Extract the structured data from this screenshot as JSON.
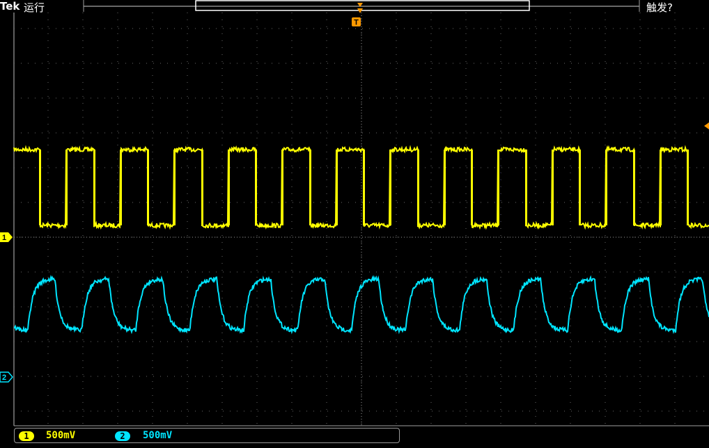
{
  "header": {
    "brand": "Tek",
    "run_state": "运行",
    "trigger_status": "触发?"
  },
  "markers": {
    "trigger_position": "T",
    "channel1_ground": "1",
    "channel2_ground": "2"
  },
  "channels": [
    {
      "id": "1",
      "scale": "500mV",
      "color": "#ffff00"
    },
    {
      "id": "2",
      "scale": "500mV",
      "color": "#00e5ff"
    }
  ],
  "colors": {
    "background": "#000000",
    "grid": "#7a7a7a",
    "frame": "#a0a0a0",
    "trigger_marker": "#ff9900"
  }
}
